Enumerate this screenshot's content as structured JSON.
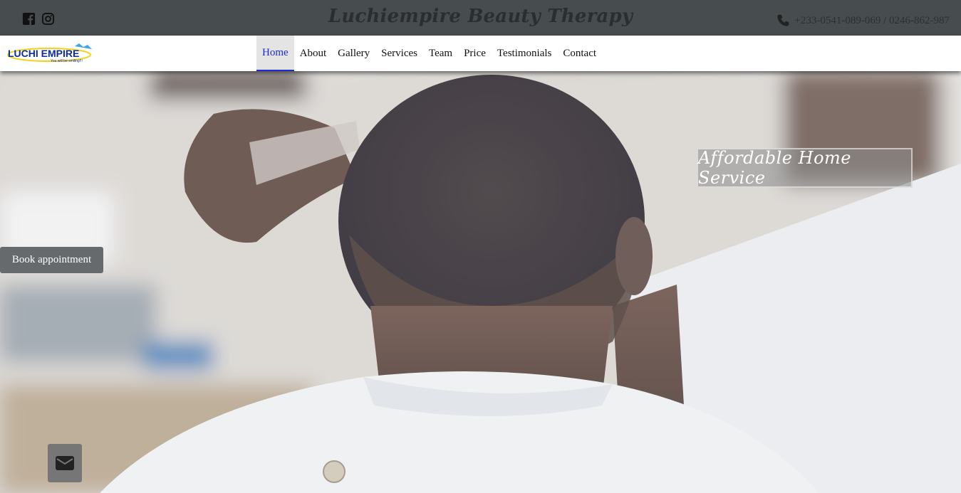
{
  "topbar": {
    "title": "Luchiempire Beauty Therapy",
    "phone": "+233-0541-089-069 / 0246-862-987",
    "social": [
      "facebook-icon",
      "instagram-icon"
    ]
  },
  "logo": {
    "text": "LUCHI EMPIRE",
    "tagline": "You will be smiling!!!"
  },
  "nav": {
    "items": [
      {
        "label": "Home",
        "active": true
      },
      {
        "label": "About"
      },
      {
        "label": "Gallery"
      },
      {
        "label": "Services"
      },
      {
        "label": "Team"
      },
      {
        "label": "Price"
      },
      {
        "label": "Testimonials"
      },
      {
        "label": "Contact"
      }
    ]
  },
  "hero": {
    "tagline": "Affordable Home Service",
    "book_label": "Book appointment",
    "mail_icon": "envelope-icon"
  },
  "colors": {
    "topbar": "#474c4e",
    "nav_active": "#1a2bd6",
    "button": "#666a6d"
  }
}
